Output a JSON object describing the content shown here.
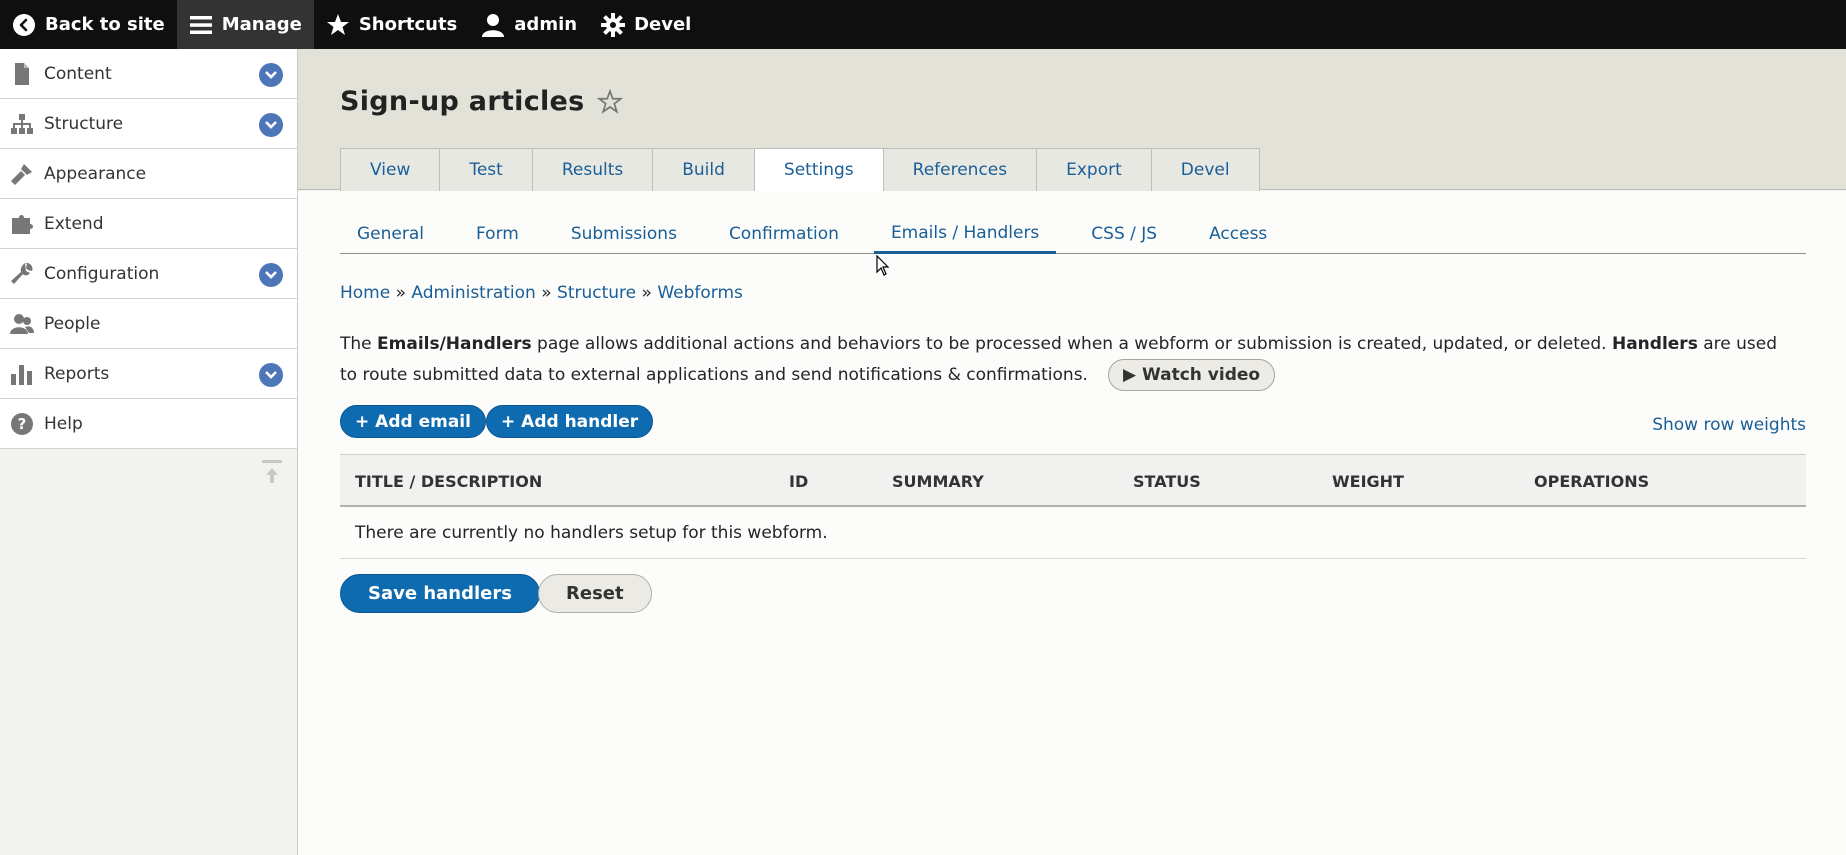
{
  "toolbar": {
    "back": "Back to site",
    "manage": "Manage",
    "shortcuts": "Shortcuts",
    "user": "admin",
    "devel": "Devel"
  },
  "sidebar": {
    "items": [
      {
        "label": "Content",
        "icon": "file-icon",
        "expandable": true
      },
      {
        "label": "Structure",
        "icon": "sitemap-icon",
        "expandable": true
      },
      {
        "label": "Appearance",
        "icon": "paintbrush-icon",
        "expandable": false
      },
      {
        "label": "Extend",
        "icon": "puzzle-icon",
        "expandable": false
      },
      {
        "label": "Configuration",
        "icon": "wrench-icon",
        "expandable": true
      },
      {
        "label": "People",
        "icon": "people-icon",
        "expandable": false
      },
      {
        "label": "Reports",
        "icon": "bar-chart-icon",
        "expandable": true
      },
      {
        "label": "Help",
        "icon": "help-icon",
        "expandable": false
      }
    ]
  },
  "page": {
    "title": "Sign-up articles"
  },
  "tabs": [
    "View",
    "Test",
    "Results",
    "Build",
    "Settings",
    "References",
    "Export",
    "Devel"
  ],
  "active_tab": "Settings",
  "subtabs": [
    "General",
    "Form",
    "Submissions",
    "Confirmation",
    "Emails / Handlers",
    "CSS / JS",
    "Access"
  ],
  "active_subtab": "Emails / Handlers",
  "breadcrumb": {
    "home": "Home",
    "admin": "Administration",
    "structure": "Structure",
    "webforms": "Webforms",
    "sep": "»"
  },
  "description": {
    "part1": "The ",
    "bold1": "Emails/Handlers",
    "part2": " page allows additional actions and behaviors to be processed when a webform or submission is created, updated, or deleted. ",
    "bold2": "Handlers",
    "part3": " are used to route submitted data to external applications and send notifications & confirmations.",
    "watch_video": "▶ Watch video"
  },
  "actions": {
    "add_email": "+ Add email",
    "add_handler": "+ Add handler",
    "show_row_weights": "Show row weights"
  },
  "table": {
    "headers": [
      "Title / Description",
      "ID",
      "Summary",
      "Status",
      "Weight",
      "Operations"
    ],
    "empty": "There are currently no handlers setup for this webform."
  },
  "buttons": {
    "save": "Save handlers",
    "reset": "Reset"
  },
  "colors": {
    "link": "#1a5e97",
    "primary_button": "#0f6bb0",
    "toolbar": "#0f0f0f",
    "header_band": "#e3e2d9"
  }
}
